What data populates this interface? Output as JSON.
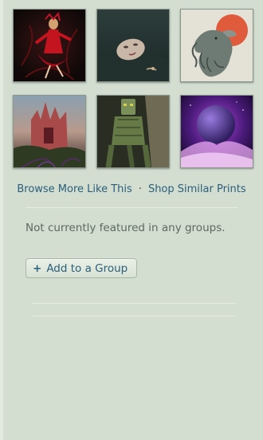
{
  "thumbnails": [
    {
      "name": "thumb-red-dancer"
    },
    {
      "name": "thumb-drowned-face"
    },
    {
      "name": "thumb-elephant-moon"
    },
    {
      "name": "thumb-red-cathedral"
    },
    {
      "name": "thumb-robot-throne"
    },
    {
      "name": "thumb-purple-planet"
    }
  ],
  "links": {
    "browse_more": "Browse More Like This",
    "separator": "·",
    "shop_similar": "Shop Similar Prints"
  },
  "groups": {
    "status_text": "Not currently featured in any groups.",
    "add_button_icon": "+",
    "add_button_label": "Add to a Group"
  },
  "colors": {
    "background": "#d3ddd0",
    "link": "#2a5f7c",
    "muted_text": "#5b6a5f"
  }
}
